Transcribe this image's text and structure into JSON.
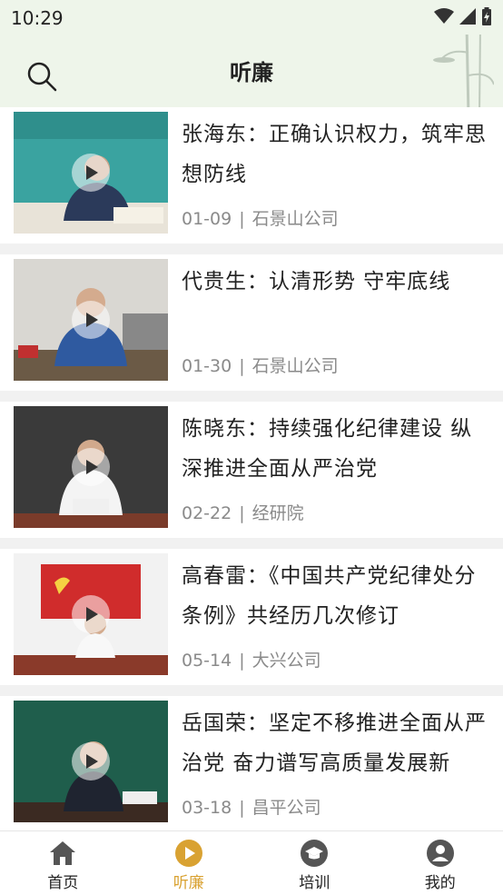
{
  "status": {
    "time": "10:29"
  },
  "header": {
    "title": "听廉"
  },
  "items": [
    {
      "title": "张海东：正确认识权力，筑牢思想防线",
      "date": "01-09",
      "source": "石景山公司"
    },
    {
      "title": "代贵生：认清形势 守牢底线",
      "date": "01-30",
      "source": "石景山公司"
    },
    {
      "title": "陈晓东：持续强化纪律建设 纵深推进全面从严治党",
      "date": "02-22",
      "source": "经研院"
    },
    {
      "title": "高春雷：《中国共产党纪律处分条例》共经历几次修订",
      "date": "05-14",
      "source": "大兴公司"
    },
    {
      "title": "岳国荣：坚定不移推进全面从严治党 奋力谱写高质量发展新",
      "date": "03-18",
      "source": "昌平公司"
    }
  ],
  "tabs": [
    {
      "label": "首页",
      "icon": "home-icon"
    },
    {
      "label": "听廉",
      "icon": "play-circle-icon",
      "active": true
    },
    {
      "label": "培训",
      "icon": "graduation-cap-icon"
    },
    {
      "label": "我的",
      "icon": "user-icon"
    }
  ],
  "colors": {
    "accent": "#d9a232",
    "header_bg": "#eef5ea"
  }
}
